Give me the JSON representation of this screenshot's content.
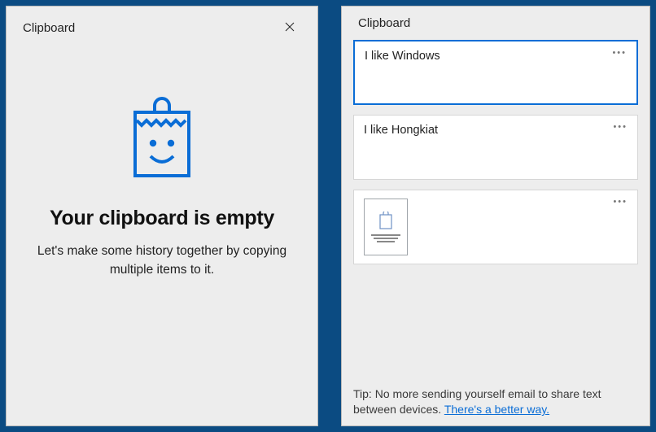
{
  "left": {
    "title": "Clipboard",
    "heading": "Your clipboard is empty",
    "subtitle": "Let's make some history together by copying multiple items to it."
  },
  "right": {
    "title": "Clipboard",
    "items": [
      {
        "text": "I like Windows",
        "selected": true,
        "type": "text"
      },
      {
        "text": "I like Hongkiat",
        "selected": false,
        "type": "text"
      },
      {
        "text": "",
        "selected": false,
        "type": "image"
      }
    ],
    "tip_prefix": "Tip: No more sending yourself email to share text between devices.  ",
    "tip_link": "There's a better way."
  },
  "colors": {
    "accent": "#0a6dd6"
  }
}
